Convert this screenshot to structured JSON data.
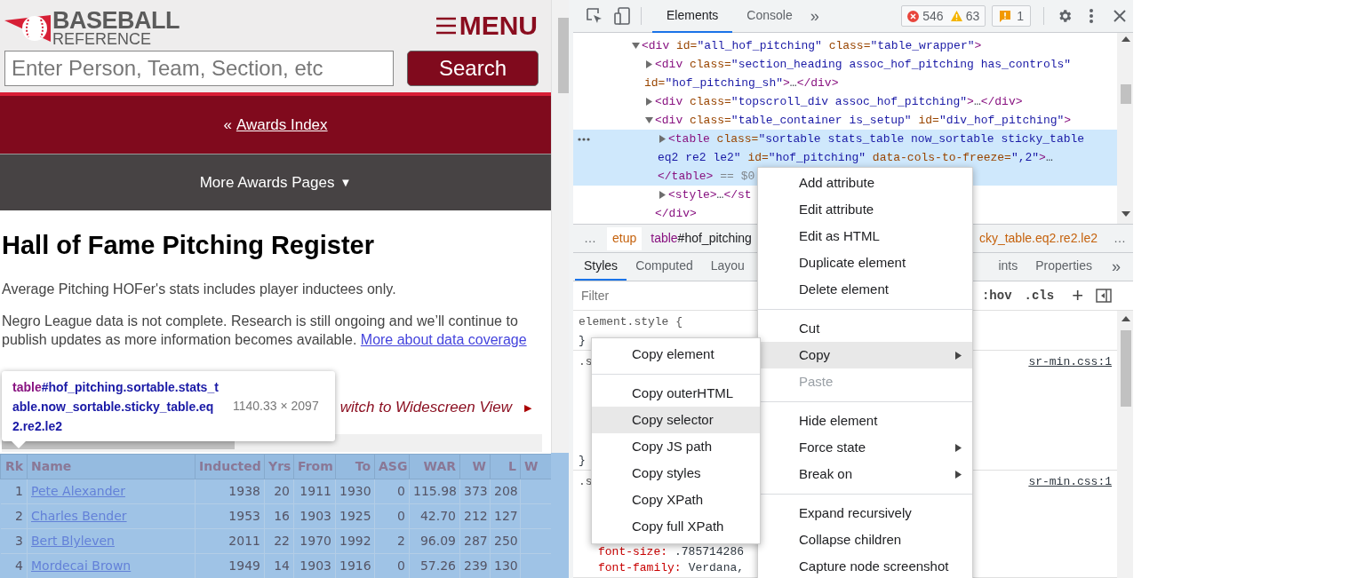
{
  "page": {
    "logo": {
      "line1": "BASEBALL",
      "line2": "REFERENCE"
    },
    "menu_button": "MENU",
    "search": {
      "placeholder": "Enter Person, Team, Section, etc",
      "button": "Search"
    },
    "back_nav": {
      "prefix": "«",
      "link": "Awards Index"
    },
    "more_awards": {
      "label": "More Awards Pages",
      "caret": "▼"
    },
    "heading": "Hall of Fame Pitching Register",
    "notes": [
      {
        "text": "Average Pitching HOFer's stats includes player inductees only."
      },
      {
        "text": "Negro League data is not complete. Research is still ongoing and we’ll continue to publish updates as more information becomes available.",
        "link": "More about data coverage"
      }
    ],
    "widescreen": {
      "label": "witch to Widescreen View",
      "arrow": "▶"
    },
    "table": {
      "columns": [
        "Rk",
        "Name",
        "Inducted",
        "Yrs",
        "From",
        "To",
        "ASG",
        "WAR",
        "W",
        "L",
        "W"
      ],
      "rows": [
        [
          "1",
          "Pete Alexander",
          "1938",
          "20",
          "1911",
          "1930",
          "0",
          "115.98",
          "373",
          "208"
        ],
        [
          "2",
          "Charles Bender",
          "1953",
          "16",
          "1903",
          "1925",
          "0",
          "42.70",
          "212",
          "127"
        ],
        [
          "3",
          "Bert Blyleven",
          "2011",
          "22",
          "1970",
          "1992",
          "2",
          "96.09",
          "287",
          "250"
        ],
        [
          "4",
          "Mordecai Brown",
          "1949",
          "14",
          "1903",
          "1916",
          "0",
          "57.26",
          "239",
          "130"
        ]
      ]
    }
  },
  "inspect_tooltip": {
    "tag": "table",
    "selector": "#hof_pitching.sortable.stats_table.now_sortable.sticky_table.eq2.re2.le2",
    "size": "1140.33 × 2097"
  },
  "devtools": {
    "tabs": [
      {
        "label": "Elements",
        "selected": true
      },
      {
        "label": "Console",
        "selected": false
      }
    ],
    "more_tabs": "»",
    "errors": "546",
    "warnings": "63",
    "issues": "1",
    "dom_tree": [
      {
        "expanded": true,
        "selected": false,
        "lines": [
          [
            {
              "kind": "tag",
              "text": "<div "
            },
            {
              "kind": "attr",
              "text": "id="
            },
            {
              "kind": "value",
              "text": "\"all_hof_pitching\""
            },
            {
              "kind": "attr",
              "text": " class="
            },
            {
              "kind": "value",
              "text": "\"table_wrapper\""
            },
            {
              "kind": "tag",
              "text": ">"
            }
          ]
        ],
        "children": [
          {
            "expanded": false,
            "selected": false,
            "lines": [
              [
                {
                  "kind": "tag",
                  "text": "<div "
                },
                {
                  "kind": "attr",
                  "text": "class="
                },
                {
                  "kind": "value",
                  "text": "\"section_heading assoc_hof_pitching has_controls\""
                }
              ],
              [
                {
                  "kind": "attr",
                  "text": "id="
                },
                {
                  "kind": "value",
                  "text": "\"hof_pitching_sh\""
                },
                {
                  "kind": "tag",
                  "text": ">"
                },
                {
                  "kind": "text",
                  "text": "…"
                },
                {
                  "kind": "tag",
                  "text": "</div>"
                }
              ]
            ]
          },
          {
            "expanded": false,
            "selected": false,
            "lines": [
              [
                {
                  "kind": "tag",
                  "text": "<div "
                },
                {
                  "kind": "attr",
                  "text": "class="
                },
                {
                  "kind": "value",
                  "text": "\"topscroll_div assoc_hof_pitching\""
                },
                {
                  "kind": "tag",
                  "text": ">"
                },
                {
                  "kind": "text",
                  "text": "…"
                },
                {
                  "kind": "tag",
                  "text": "</div>"
                }
              ]
            ]
          },
          {
            "expanded": true,
            "selected": false,
            "lines": [
              [
                {
                  "kind": "tag",
                  "text": "<div "
                },
                {
                  "kind": "attr",
                  "text": "class="
                },
                {
                  "kind": "value",
                  "text": "\"table_container is_setup\""
                },
                {
                  "kind": "attr",
                  "text": " id="
                },
                {
                  "kind": "value",
                  "text": "\"div_hof_pitching\""
                },
                {
                  "kind": "tag",
                  "text": ">"
                }
              ]
            ],
            "children": [
              {
                "expanded": false,
                "selected": true,
                "lines": [
                  [
                    {
                      "kind": "tag",
                      "text": "<table "
                    },
                    {
                      "kind": "attr",
                      "text": "class="
                    },
                    {
                      "kind": "value",
                      "text": "\"sortable stats_table now_sortable sticky_table"
                    }
                  ],
                  [
                    {
                      "kind": "value",
                      "text": "eq2 re2 le2\""
                    },
                    {
                      "kind": "attr",
                      "text": " id="
                    },
                    {
                      "kind": "value",
                      "text": "\"hof_pitching\""
                    },
                    {
                      "kind": "attr",
                      "text": " data-cols-to-freeze="
                    },
                    {
                      "kind": "value",
                      "text": "\",2\""
                    },
                    {
                      "kind": "tag",
                      "text": ">"
                    },
                    {
                      "kind": "text",
                      "text": "…"
                    }
                  ],
                  [
                    {
                      "kind": "tag",
                      "text": "</table>"
                    },
                    {
                      "kind": "dim",
                      "text": " == $0"
                    }
                  ]
                ]
              },
              {
                "expanded": false,
                "selected": false,
                "lines": [
                  [
                    {
                      "kind": "tag",
                      "text": "<style>"
                    },
                    {
                      "kind": "text",
                      "text": "…"
                    },
                    {
                      "kind": "tag",
                      "text": "</st"
                    }
                  ]
                ]
              }
            ],
            "closing": [
              {
                "kind": "tag",
                "text": "</div>"
              }
            ]
          }
        ]
      }
    ],
    "breadcrumbs": {
      "overflow_left": "…",
      "left": [
        [
          {
            "kind": "class",
            "text": "etup"
          }
        ],
        [
          {
            "kind": "tag",
            "text": "table"
          },
          {
            "kind": "id",
            "text": "#hof_pitching"
          }
        ]
      ],
      "right": [
        [
          {
            "kind": "class",
            "text": "cky_table.eq2.re2.le2"
          }
        ]
      ],
      "overflow_right": "…"
    },
    "styles_tabs": {
      "left": [
        {
          "label": "Styles",
          "selected": true
        },
        {
          "label": "Computed",
          "selected": false
        },
        {
          "label": "Layou",
          "selected": false
        }
      ],
      "right": [
        {
          "label": "ints",
          "selected": false
        },
        {
          "label": "Properties",
          "selected": false
        }
      ],
      "more": "»"
    },
    "filter": {
      "placeholder": "Filter",
      "hov": ":hov",
      "cls": ".cls",
      "add": "+"
    },
    "rules": [
      {
        "selector": "element.style {",
        "close": "}"
      },
      {
        "selector": ".s",
        "source": "sr-min.css:1",
        "close": "}"
      },
      {
        "selector": ".s",
        "source": "sr-min.css:1",
        "declarations": [
          {
            "property": "font-size:",
            "value": ".785714286"
          },
          {
            "property": "font-family:",
            "value": "Verdana,"
          }
        ]
      }
    ]
  },
  "context_menu": {
    "groups": [
      [
        {
          "label": "Add attribute",
          "selected": false,
          "disabled": false,
          "submenu": false
        },
        {
          "label": "Edit attribute",
          "selected": false,
          "disabled": false,
          "submenu": false
        },
        {
          "label": "Edit as HTML",
          "selected": false,
          "disabled": false,
          "submenu": false
        },
        {
          "label": "Duplicate element",
          "selected": false,
          "disabled": false,
          "submenu": false
        },
        {
          "label": "Delete element",
          "selected": false,
          "disabled": false,
          "submenu": false
        }
      ],
      [
        {
          "label": "Cut",
          "selected": false,
          "disabled": false,
          "submenu": false
        },
        {
          "label": "Copy",
          "selected": true,
          "disabled": false,
          "submenu": true
        },
        {
          "label": "Paste",
          "selected": false,
          "disabled": true,
          "submenu": false
        }
      ],
      [
        {
          "label": "Hide element",
          "selected": false,
          "disabled": false,
          "submenu": false
        },
        {
          "label": "Force state",
          "selected": false,
          "disabled": false,
          "submenu": true
        },
        {
          "label": "Break on",
          "selected": false,
          "disabled": false,
          "submenu": true
        }
      ],
      [
        {
          "label": "Expand recursively",
          "selected": false,
          "disabled": false,
          "submenu": false
        },
        {
          "label": "Collapse children",
          "selected": false,
          "disabled": false,
          "submenu": false
        },
        {
          "label": "Capture node screenshot",
          "selected": false,
          "disabled": false,
          "submenu": false
        }
      ]
    ]
  },
  "copy_submenu": {
    "groups": [
      [
        {
          "label": "Copy element",
          "selected": false
        }
      ],
      [
        {
          "label": "Copy outerHTML",
          "selected": false
        },
        {
          "label": "Copy selector",
          "selected": true
        },
        {
          "label": "Copy JS path",
          "selected": false
        },
        {
          "label": "Copy styles",
          "selected": false
        },
        {
          "label": "Copy XPath",
          "selected": false
        },
        {
          "label": "Copy full XPath",
          "selected": false
        }
      ]
    ]
  }
}
